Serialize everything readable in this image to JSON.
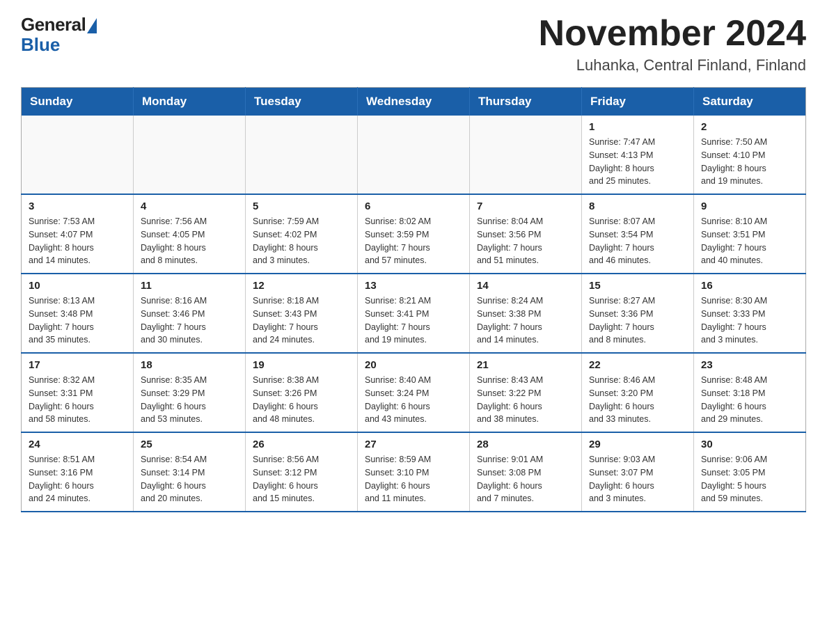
{
  "logo": {
    "general": "General",
    "blue": "Blue"
  },
  "title": "November 2024",
  "location": "Luhanka, Central Finland, Finland",
  "days_of_week": [
    "Sunday",
    "Monday",
    "Tuesday",
    "Wednesday",
    "Thursday",
    "Friday",
    "Saturday"
  ],
  "weeks": [
    [
      {
        "day": "",
        "info": ""
      },
      {
        "day": "",
        "info": ""
      },
      {
        "day": "",
        "info": ""
      },
      {
        "day": "",
        "info": ""
      },
      {
        "day": "",
        "info": ""
      },
      {
        "day": "1",
        "info": "Sunrise: 7:47 AM\nSunset: 4:13 PM\nDaylight: 8 hours\nand 25 minutes."
      },
      {
        "day": "2",
        "info": "Sunrise: 7:50 AM\nSunset: 4:10 PM\nDaylight: 8 hours\nand 19 minutes."
      }
    ],
    [
      {
        "day": "3",
        "info": "Sunrise: 7:53 AM\nSunset: 4:07 PM\nDaylight: 8 hours\nand 14 minutes."
      },
      {
        "day": "4",
        "info": "Sunrise: 7:56 AM\nSunset: 4:05 PM\nDaylight: 8 hours\nand 8 minutes."
      },
      {
        "day": "5",
        "info": "Sunrise: 7:59 AM\nSunset: 4:02 PM\nDaylight: 8 hours\nand 3 minutes."
      },
      {
        "day": "6",
        "info": "Sunrise: 8:02 AM\nSunset: 3:59 PM\nDaylight: 7 hours\nand 57 minutes."
      },
      {
        "day": "7",
        "info": "Sunrise: 8:04 AM\nSunset: 3:56 PM\nDaylight: 7 hours\nand 51 minutes."
      },
      {
        "day": "8",
        "info": "Sunrise: 8:07 AM\nSunset: 3:54 PM\nDaylight: 7 hours\nand 46 minutes."
      },
      {
        "day": "9",
        "info": "Sunrise: 8:10 AM\nSunset: 3:51 PM\nDaylight: 7 hours\nand 40 minutes."
      }
    ],
    [
      {
        "day": "10",
        "info": "Sunrise: 8:13 AM\nSunset: 3:48 PM\nDaylight: 7 hours\nand 35 minutes."
      },
      {
        "day": "11",
        "info": "Sunrise: 8:16 AM\nSunset: 3:46 PM\nDaylight: 7 hours\nand 30 minutes."
      },
      {
        "day": "12",
        "info": "Sunrise: 8:18 AM\nSunset: 3:43 PM\nDaylight: 7 hours\nand 24 minutes."
      },
      {
        "day": "13",
        "info": "Sunrise: 8:21 AM\nSunset: 3:41 PM\nDaylight: 7 hours\nand 19 minutes."
      },
      {
        "day": "14",
        "info": "Sunrise: 8:24 AM\nSunset: 3:38 PM\nDaylight: 7 hours\nand 14 minutes."
      },
      {
        "day": "15",
        "info": "Sunrise: 8:27 AM\nSunset: 3:36 PM\nDaylight: 7 hours\nand 8 minutes."
      },
      {
        "day": "16",
        "info": "Sunrise: 8:30 AM\nSunset: 3:33 PM\nDaylight: 7 hours\nand 3 minutes."
      }
    ],
    [
      {
        "day": "17",
        "info": "Sunrise: 8:32 AM\nSunset: 3:31 PM\nDaylight: 6 hours\nand 58 minutes."
      },
      {
        "day": "18",
        "info": "Sunrise: 8:35 AM\nSunset: 3:29 PM\nDaylight: 6 hours\nand 53 minutes."
      },
      {
        "day": "19",
        "info": "Sunrise: 8:38 AM\nSunset: 3:26 PM\nDaylight: 6 hours\nand 48 minutes."
      },
      {
        "day": "20",
        "info": "Sunrise: 8:40 AM\nSunset: 3:24 PM\nDaylight: 6 hours\nand 43 minutes."
      },
      {
        "day": "21",
        "info": "Sunrise: 8:43 AM\nSunset: 3:22 PM\nDaylight: 6 hours\nand 38 minutes."
      },
      {
        "day": "22",
        "info": "Sunrise: 8:46 AM\nSunset: 3:20 PM\nDaylight: 6 hours\nand 33 minutes."
      },
      {
        "day": "23",
        "info": "Sunrise: 8:48 AM\nSunset: 3:18 PM\nDaylight: 6 hours\nand 29 minutes."
      }
    ],
    [
      {
        "day": "24",
        "info": "Sunrise: 8:51 AM\nSunset: 3:16 PM\nDaylight: 6 hours\nand 24 minutes."
      },
      {
        "day": "25",
        "info": "Sunrise: 8:54 AM\nSunset: 3:14 PM\nDaylight: 6 hours\nand 20 minutes."
      },
      {
        "day": "26",
        "info": "Sunrise: 8:56 AM\nSunset: 3:12 PM\nDaylight: 6 hours\nand 15 minutes."
      },
      {
        "day": "27",
        "info": "Sunrise: 8:59 AM\nSunset: 3:10 PM\nDaylight: 6 hours\nand 11 minutes."
      },
      {
        "day": "28",
        "info": "Sunrise: 9:01 AM\nSunset: 3:08 PM\nDaylight: 6 hours\nand 7 minutes."
      },
      {
        "day": "29",
        "info": "Sunrise: 9:03 AM\nSunset: 3:07 PM\nDaylight: 6 hours\nand 3 minutes."
      },
      {
        "day": "30",
        "info": "Sunrise: 9:06 AM\nSunset: 3:05 PM\nDaylight: 5 hours\nand 59 minutes."
      }
    ]
  ]
}
